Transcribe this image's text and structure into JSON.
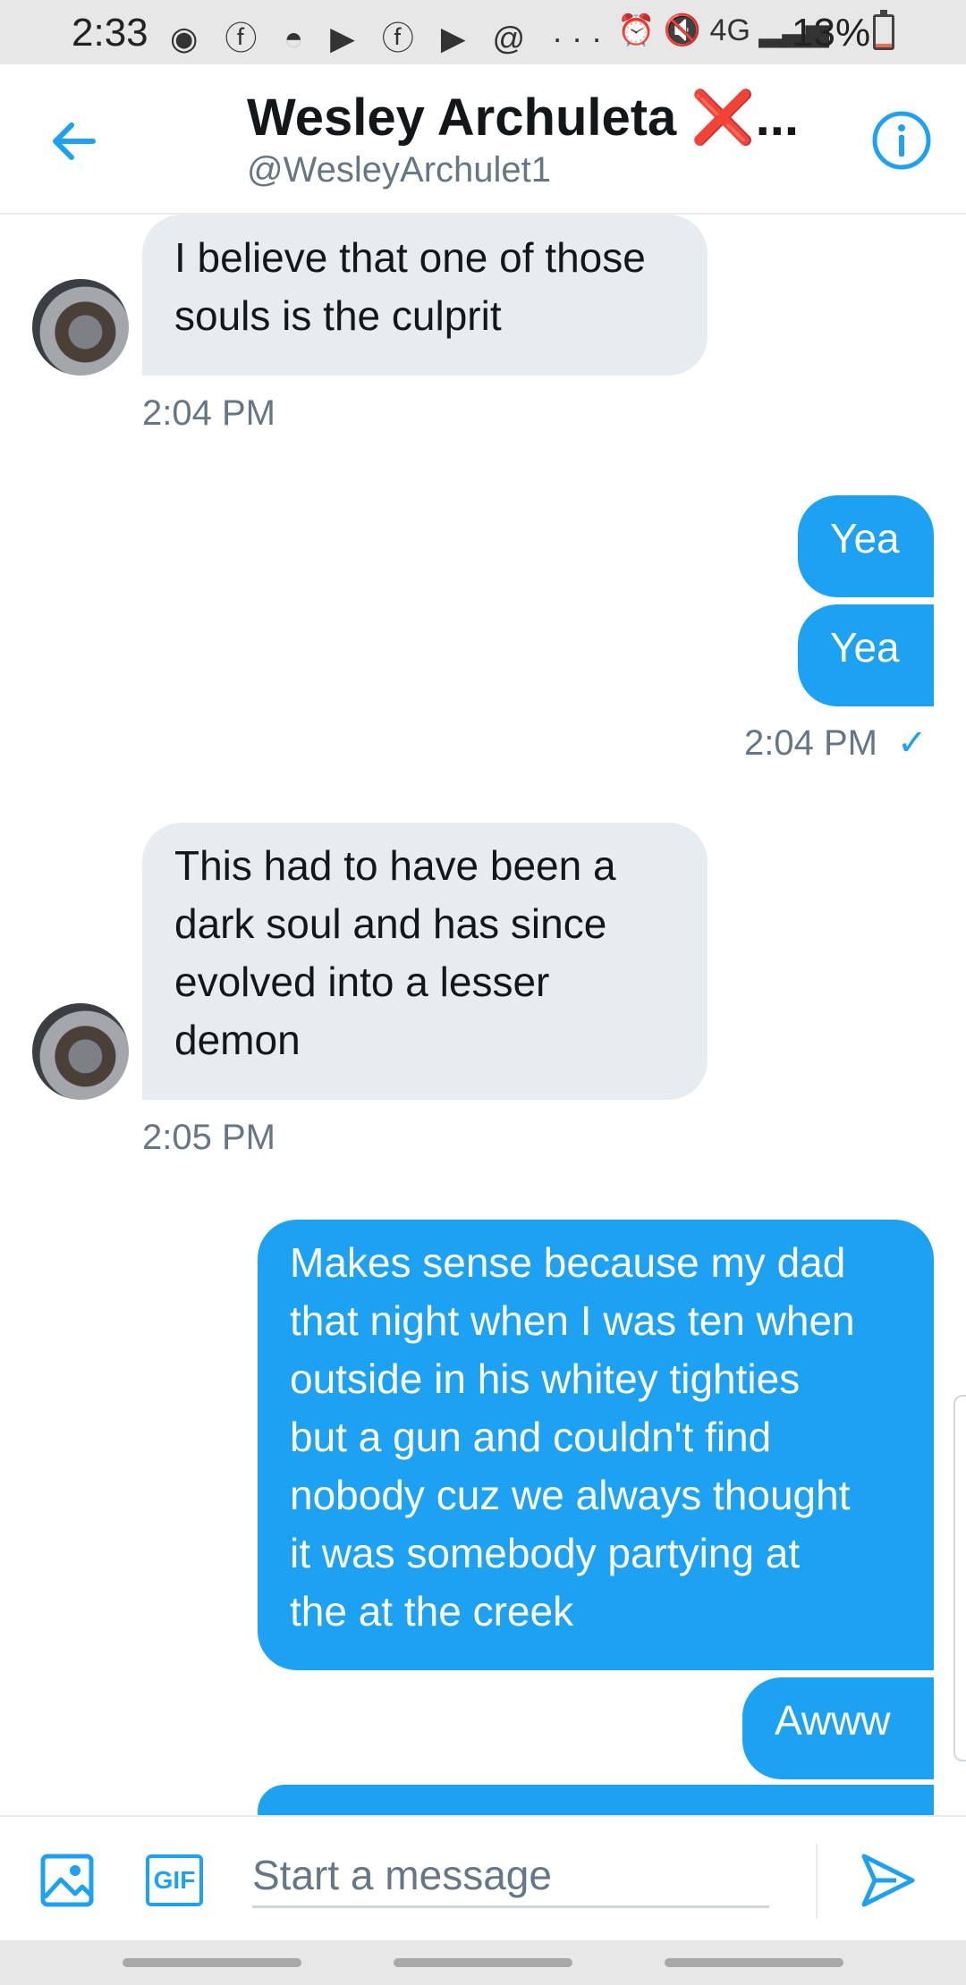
{
  "status_bar": {
    "time": "2:33",
    "left_icons": "◉ ⓕ ◓ ▶ ⓕ ▶ @ ···",
    "right_icons": "⏰ 🔇 4G ▂▃▅",
    "battery_percent": "13%",
    "battery_level": 0.13
  },
  "header": {
    "name": "Wesley Archuleta ❌...",
    "handle": "@WesleyArchulet1",
    "back_icon": "arrow-left-icon",
    "info_icon": "info-circle-icon"
  },
  "messages": [
    {
      "sender": "them",
      "text": "I believe that one of those souls is the culprit",
      "lines": [
        "I believe that one of those",
        "souls is the culprit"
      ]
    },
    {
      "sender": "them",
      "timestamp": "2:04 PM"
    },
    {
      "sender": "me",
      "text": "Yea"
    },
    {
      "sender": "me",
      "text": "Yea"
    },
    {
      "sender": "me",
      "timestamp": "2:04 PM",
      "read_check": "✓"
    },
    {
      "sender": "them",
      "text": "This had to have been a dark soul and has since evolved into a lesser demon",
      "lines": [
        "This had to have been a",
        "dark soul and has since",
        "evolved into a lesser",
        "demon"
      ]
    },
    {
      "sender": "them",
      "timestamp": "2:05 PM"
    },
    {
      "sender": "me",
      "text": "Makes sense because my dad that night when I was ten when outside in his whitey tighties but a gun and couldn't find nobody cuz we always thought it was somebody partying at the at the creek",
      "lines": [
        "Makes sense because my dad",
        "that night when I was ten when",
        "outside in his whitey tighties",
        "but a gun and couldn't find",
        "nobody cuz we always thought",
        "it was somebody partying at",
        "the at the creek"
      ]
    },
    {
      "sender": "me",
      "text": "Awww"
    }
  ],
  "composer": {
    "placeholder": "Start a message",
    "image_icon": "image-icon",
    "gif_label": "GIF",
    "send_icon": "send-icon"
  },
  "colors": {
    "accent": "#1da1f2",
    "incoming_bubble": "#e6ecf0",
    "secondary_text": "#657786"
  }
}
